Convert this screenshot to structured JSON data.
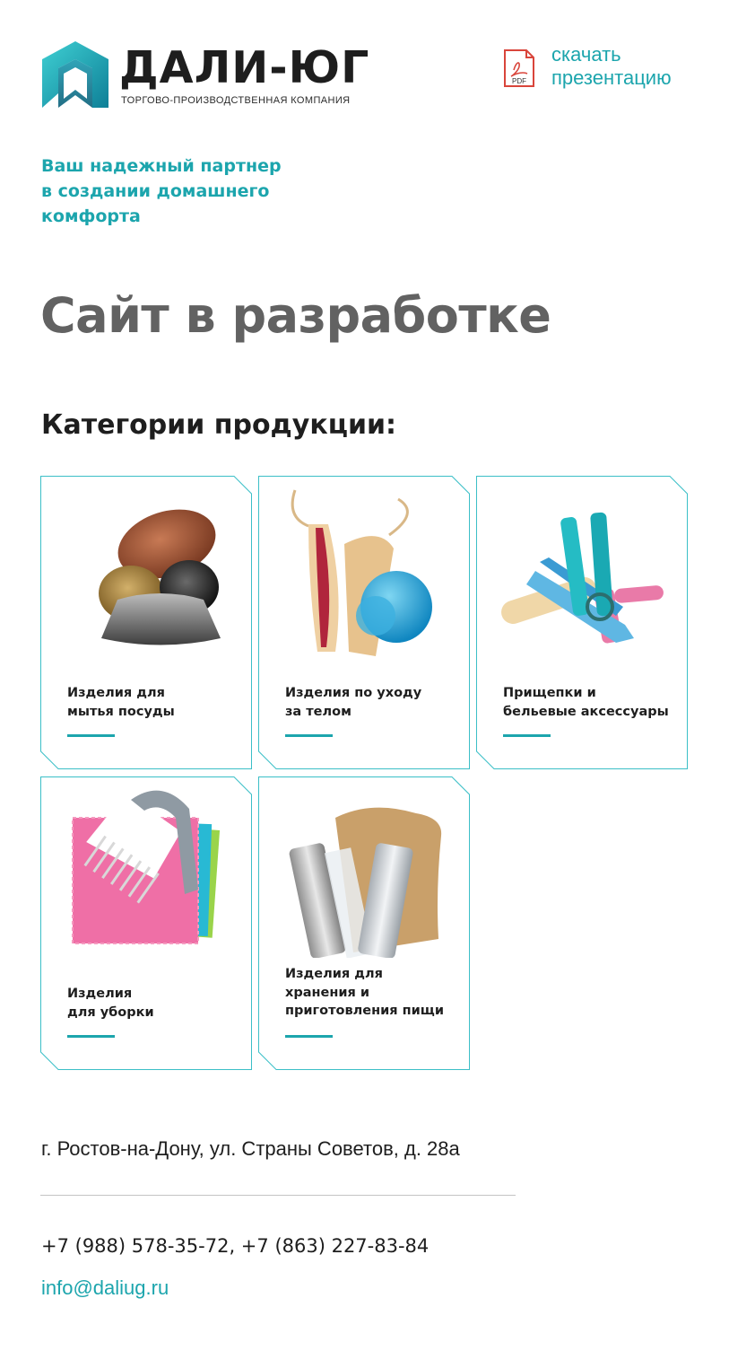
{
  "brand": {
    "name": "ДАЛИ-ЮГ",
    "tagline": "ТОРГОВО-ПРОИЗВОДСТВЕННАЯ КОМПАНИЯ",
    "logo_icon": "house-logo-icon",
    "accent_color": "#1ca5ad"
  },
  "presentation": {
    "icon": "pdf-file-icon",
    "icon_text": "PDF",
    "line1": "скачать",
    "line2": "презентацию"
  },
  "hero": {
    "tagline_line1": "Ваш надежный партнер",
    "tagline_line2": "в создании домашнего",
    "tagline_line3": "комфорта",
    "status_title": "Сайт в разработке"
  },
  "categories": {
    "heading": "Категории продукции:",
    "items": [
      {
        "line1": "Изделия для",
        "line2": "мытья посуды",
        "line3": "",
        "image": "dish-scrubbers-image"
      },
      {
        "line1": "Изделия по уходу",
        "line2": "за телом",
        "line3": "",
        "image": "bath-sponges-image"
      },
      {
        "line1": "Прищепки и",
        "line2": "бельевые аксессуары",
        "line3": "",
        "image": "clothespins-image"
      },
      {
        "line1": "Изделия",
        "line2": "для уборки",
        "line3": "",
        "image": "cleaning-brush-cloths-image"
      },
      {
        "line1": "Изделия для",
        "line2": "хранения и",
        "line3": "приготовления пищи",
        "image": "foil-film-rolls-image"
      }
    ]
  },
  "contacts": {
    "address": "г. Ростов-на-Дону, ул. Страны Советов, д. 28а",
    "phones": "+7 (988) 578-35-72, +7 (863) 227-83-84",
    "email": "info@daliug.ru"
  }
}
